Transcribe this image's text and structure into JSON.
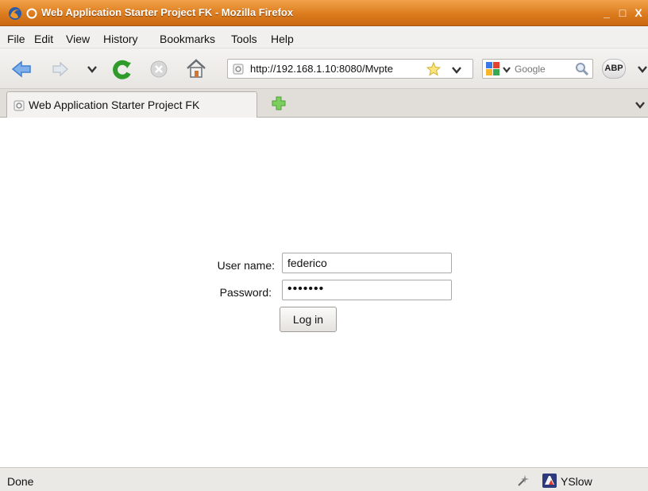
{
  "window": {
    "title": "Web Application Starter Project FK - Mozilla Firefox",
    "minimize": "_",
    "maximize": "□",
    "close": "X"
  },
  "menu": {
    "items": [
      {
        "label": "File"
      },
      {
        "label": "Edit"
      },
      {
        "label": "View"
      },
      {
        "label": "History"
      },
      {
        "label": "Bookmarks"
      },
      {
        "label": "Tools"
      },
      {
        "label": "Help"
      }
    ]
  },
  "navigation": {
    "url": "http://192.168.1.10:8080/Mvpte",
    "search_placeholder": "Google",
    "addon_label": "ABP"
  },
  "tabs": [
    {
      "label": "Web Application Starter Project FK"
    }
  ],
  "login_form": {
    "username_label": "User name:",
    "username_value": "federico",
    "password_label": "Password:",
    "password_value": "•••••••",
    "submit_label": "Log in"
  },
  "status": {
    "text": "Done",
    "yslow_label": "YSlow"
  },
  "colors": {
    "titlebar": "#dc7c1e",
    "nav_arrow": "#3f7fd2",
    "reload": "#2f9c2a"
  }
}
